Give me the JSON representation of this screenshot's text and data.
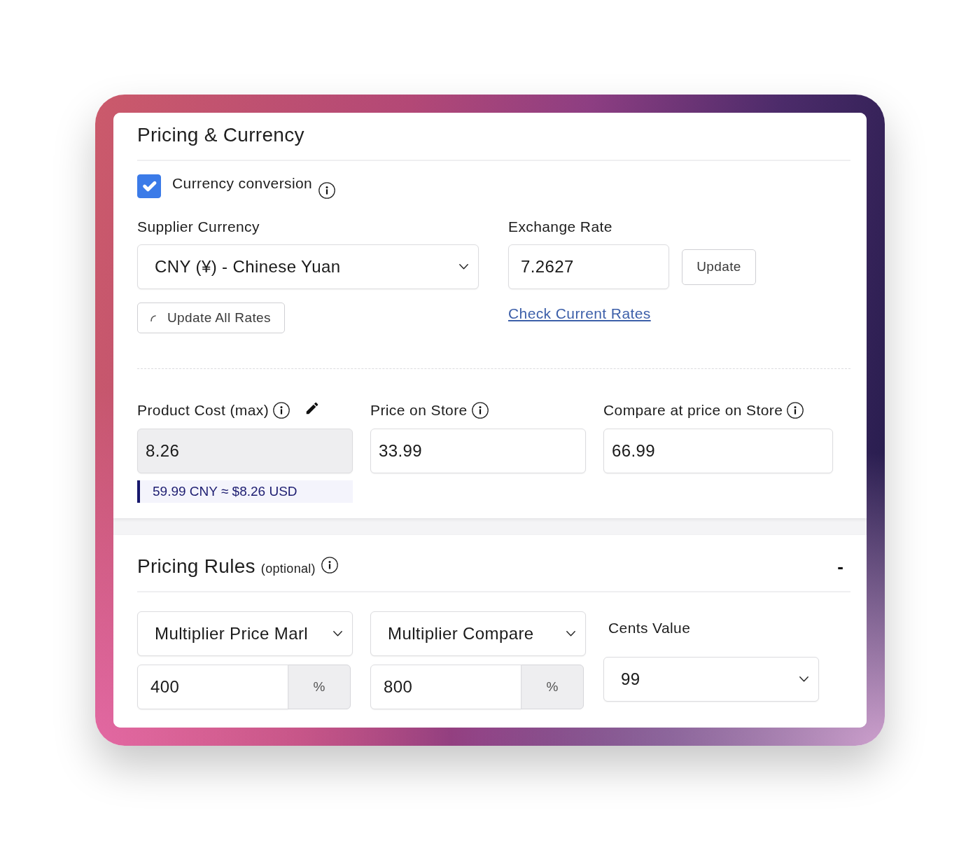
{
  "currency_section": {
    "title": "Pricing & Currency",
    "conversion": {
      "label": "Currency conversion",
      "checked": true
    },
    "supplier_currency": {
      "label": "Supplier Currency",
      "value": "CNY (¥) - Chinese Yuan"
    },
    "update_all_button": "Update All Rates",
    "exchange_rate": {
      "label": "Exchange Rate",
      "value": "7.2627",
      "button": "Update",
      "link": "Check Current Rates"
    }
  },
  "price_fields": [
    {
      "label": "Product Cost (max)",
      "value": "8.26",
      "readonly": true,
      "note": "59.99 CNY ≈ $8.26 USD"
    },
    {
      "label": "Price on Store",
      "value": "33.99",
      "readonly": false
    },
    {
      "label": "Compare at price on Store",
      "value": "66.99",
      "readonly": false
    }
  ],
  "pricing_rules": {
    "title": "Pricing Rules",
    "subtitle": "(optional)",
    "toggle": "-",
    "rules": [
      {
        "method": "Multiplier Price Marl",
        "value": "400",
        "unit": "%"
      },
      {
        "method": "Multiplier Compare",
        "value": "800",
        "unit": "%"
      }
    ],
    "cents": {
      "label": "Cents Value",
      "value": "99"
    }
  }
}
